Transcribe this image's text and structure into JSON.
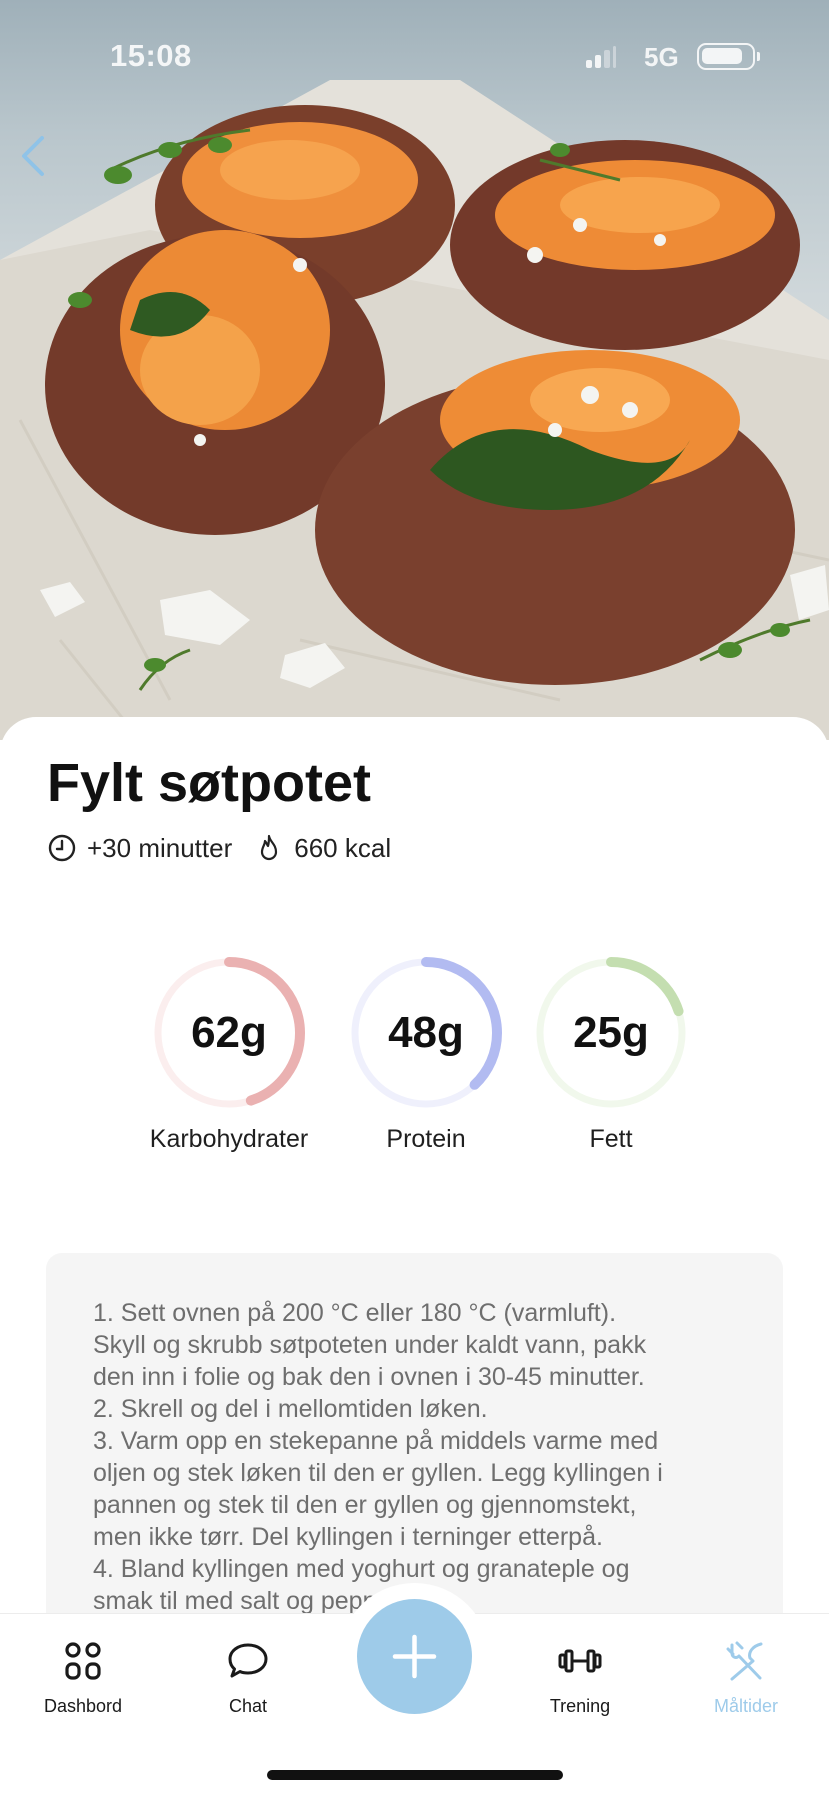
{
  "status_bar": {
    "time": "15:08",
    "network": "5G"
  },
  "hero": {
    "image": "stuffed-sweet-potatoes-photo"
  },
  "recipe": {
    "title": "Fylt søtpotet",
    "time": "+30 minutter",
    "calories": "660 kcal"
  },
  "macros": [
    {
      "value": "62g",
      "label": "Karbohydrater",
      "fraction": 0.45,
      "color": "#eab1b1",
      "track": "#fbeeee"
    },
    {
      "value": "48g",
      "label": "Protein",
      "fraction": 0.38,
      "color": "#b2bbf1",
      "track": "#eff0fc"
    },
    {
      "value": "25g",
      "label": "Fett",
      "fraction": 0.2,
      "color": "#c4deb0",
      "track": "#f1f8ec"
    }
  ],
  "instructions": [
    "1. Sett ovnen på 200 °C eller 180 °C (varmluft).",
    "Skyll og skrubb søtpoteten under kaldt vann, pakk",
    "den inn i folie og bak den i ovnen i 30-45 minutter.",
    "2. Skrell og del i mellomtiden løken.",
    "3. Varm opp en stekepanne på middels varme med",
    "oljen og stek løken til den er gyllen. Legg kyllingen i",
    "pannen og stek til den er gyllen og gjennomstekt,",
    "men ikke tørr. Del kyllingen i terninger etterpå.",
    "4. Bland kyllingen med yoghurt og granateple og",
    "smak til med salt og pepper."
  ],
  "tabbar": {
    "dashboard": "Dashbord",
    "chat": "Chat",
    "training": "Trening",
    "meals": "Måltider",
    "accent": "#9ecbe9"
  }
}
